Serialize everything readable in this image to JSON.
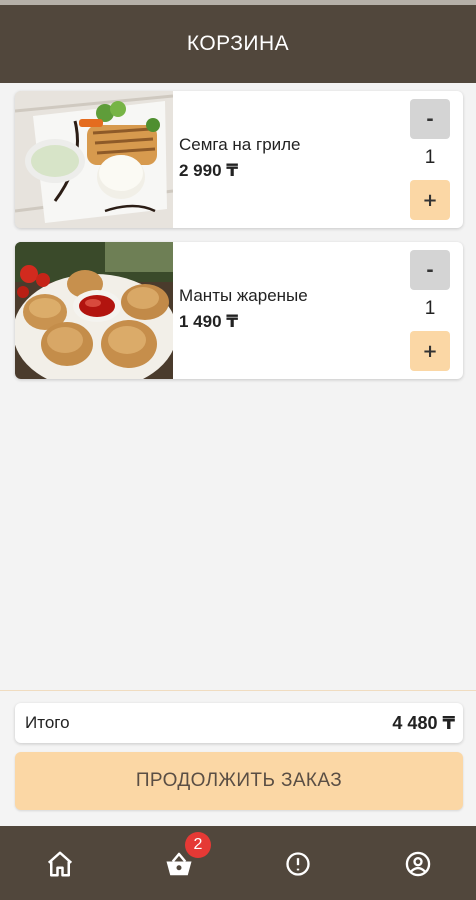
{
  "header": {
    "title": "КОРЗИНА"
  },
  "cart": {
    "items": [
      {
        "name": "Семга на гриле",
        "price": "2 990 ₸",
        "quantity": "1",
        "minus_label": "-",
        "plus_label": "+"
      },
      {
        "name": "Манты жареные",
        "price": "1 490 ₸",
        "quantity": "1",
        "minus_label": "-",
        "plus_label": "+"
      }
    ]
  },
  "summary": {
    "total_label": "Итого",
    "total_value": "4 480 ₸"
  },
  "actions": {
    "continue_label": "ПРОДОЛЖИТЬ ЗАКАЗ"
  },
  "nav": {
    "items": [
      {
        "icon": "home-icon"
      },
      {
        "icon": "basket-icon",
        "badge": "2"
      },
      {
        "icon": "alert-circle-icon"
      },
      {
        "icon": "user-circle-icon"
      }
    ]
  },
  "colors": {
    "header_bg": "#51473c",
    "accent": "#fbd7a5",
    "minus_bg": "#d4d4d4",
    "badge": "#e53935",
    "background": "#f3f3f3"
  }
}
